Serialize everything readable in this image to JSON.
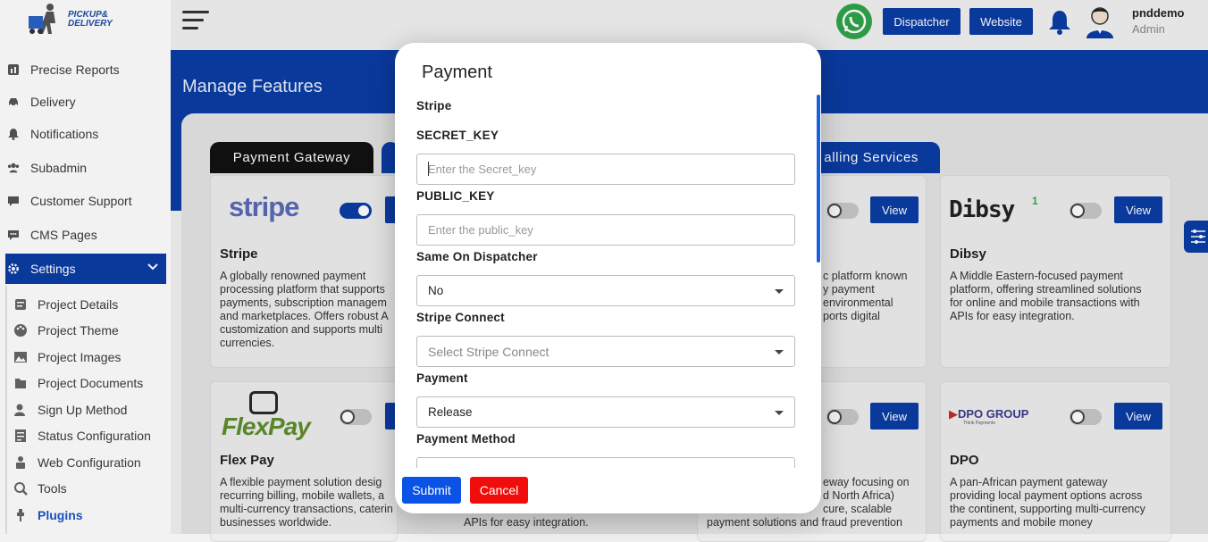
{
  "app": {
    "logo_text_1": "PICKUP&",
    "logo_text_2": "DELIVERY"
  },
  "header": {
    "dispatcher_label": "Dispatcher",
    "website_label": "Website",
    "user_name": "pnddemo",
    "user_role": "Admin"
  },
  "sidebar": {
    "items": [
      {
        "label": "Precise Reports",
        "icon": "reports-icon"
      },
      {
        "label": "Delivery",
        "icon": "car-icon"
      },
      {
        "label": "Notifications",
        "icon": "bell-icon"
      },
      {
        "label": "Subadmin",
        "icon": "users-icon"
      },
      {
        "label": "Customer Support",
        "icon": "support-icon"
      },
      {
        "label": "CMS Pages",
        "icon": "chat-icon"
      },
      {
        "label": "Settings",
        "icon": "gear-icon"
      }
    ],
    "sub_items": [
      {
        "label": "Project Details",
        "icon": "details-icon"
      },
      {
        "label": "Project Theme",
        "icon": "palette-icon"
      },
      {
        "label": "Project Images",
        "icon": "image-icon"
      },
      {
        "label": "Project Documents",
        "icon": "document-icon"
      },
      {
        "label": "Sign Up Method",
        "icon": "signup-icon"
      },
      {
        "label": "Status Configuration",
        "icon": "status-icon"
      },
      {
        "label": "Web Configuration",
        "icon": "web-icon"
      },
      {
        "label": "Tools",
        "icon": "tools-icon"
      },
      {
        "label": "Plugins",
        "icon": "plugin-icon"
      }
    ]
  },
  "main": {
    "title": "Manage Features",
    "tabs": [
      {
        "label": "Payment Gateway",
        "active": true
      },
      {
        "label": "",
        "active": false
      },
      {
        "label": "alling Services",
        "active": false
      }
    ],
    "cards": [
      {
        "brand": "stripe",
        "title": "Stripe",
        "desc": [
          "A globally renowned payment",
          "processing platform that supports",
          "payments, subscription managem",
          "and marketplaces. Offers robust A",
          "customization and supports multi",
          "currencies."
        ],
        "enabled": true
      },
      {
        "brand": "",
        "title": "",
        "desc": [
          "c platform known",
          "y payment",
          "environmental",
          "ports digital"
        ],
        "enabled": false,
        "view_label": "View"
      },
      {
        "brand": "Dibsy",
        "title": "Dibsy",
        "desc": [
          "A Middle Eastern-focused payment",
          "platform, offering streamlined solutions",
          "for online and mobile transactions with",
          "APIs for easy integration."
        ],
        "enabled": false,
        "view_label": "View"
      },
      {
        "brand": "FlexPay",
        "title": "Flex Pay",
        "desc": [
          "A flexible payment solution desig",
          "recurring billing, mobile wallets, a",
          "multi-currency transactions, caterin",
          "businesses worldwide."
        ],
        "enabled": false
      },
      {
        "brand": "",
        "title": "",
        "desc": [
          "APIs for easy integration."
        ],
        "enabled": false
      },
      {
        "brand": "",
        "title": "",
        "desc": [
          "eway focusing on",
          "d North Africa)",
          "cure, scalable",
          "payment solutions and fraud prevention"
        ],
        "enabled": false,
        "view_label": "View"
      },
      {
        "brand": "DPO GROUP",
        "brand_sub": "Think Payments",
        "title": "DPO",
        "desc": [
          "A pan-African payment gateway",
          "providing local payment options across",
          "the continent, supporting multi-currency",
          "payments and mobile money"
        ],
        "enabled": false,
        "view_label": "View"
      }
    ]
  },
  "modal": {
    "title": "Payment",
    "section": "Stripe",
    "secret_key_label": "SECRET_KEY",
    "secret_key_placeholder": "Enter the Secret_key",
    "secret_key_value": "",
    "public_key_label": "PUBLIC_KEY",
    "public_key_placeholder": "Enter the public_key",
    "public_key_value": "",
    "same_on_dispatcher_label": "Same On Dispatcher",
    "same_on_dispatcher_value": "No",
    "stripe_connect_label": "Stripe Connect",
    "stripe_connect_placeholder": "Select Stripe Connect",
    "payment_label": "Payment",
    "payment_value": "Release",
    "payment_method_label": "Payment Method",
    "submit_label": "Submit",
    "cancel_label": "Cancel"
  },
  "colors": {
    "primary": "#0b3da5",
    "submit": "#0b53e6",
    "cancel": "#f20d0d",
    "whatsapp": "#2fa44a"
  }
}
